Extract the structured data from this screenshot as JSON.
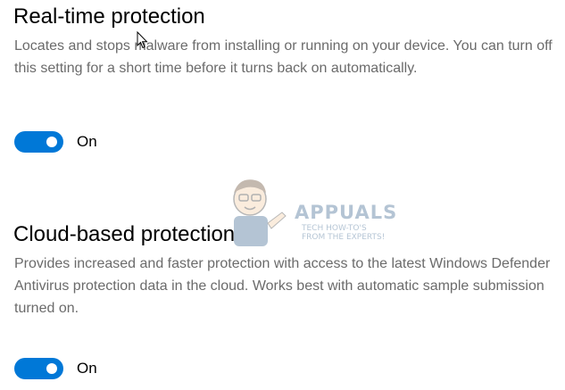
{
  "realtime": {
    "title": "Real-time protection",
    "description": "Locates and stops malware from installing or running on your device. You can turn off this setting for a short time before it turns back on automatically.",
    "toggle_state": "On",
    "enabled": true
  },
  "cloud": {
    "title": "Cloud-based protection",
    "description": "Provides increased and faster protection with access to the latest Windows Defender Antivirus protection data in the cloud. Works best with automatic sample submission turned on.",
    "toggle_state": "On",
    "enabled": true
  },
  "watermark": {
    "brand": "APPUALS",
    "tagline": "TECH HOW-TO'S FROM THE EXPERTS!"
  },
  "colors": {
    "accent": "#0078d7",
    "description_text": "#6b6b6b",
    "background": "#ffffff"
  }
}
